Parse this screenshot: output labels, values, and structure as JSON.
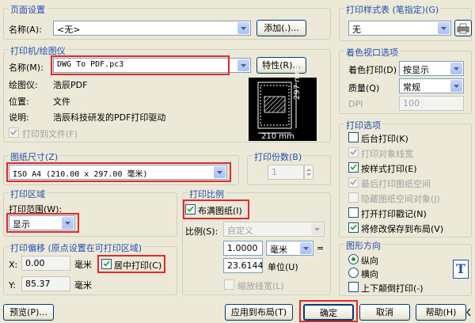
{
  "page_setup": {
    "title": "页面设置",
    "name_label": "名称(A):",
    "name_value": "<无>",
    "add_button": "添加(.)..."
  },
  "printer": {
    "title": "打印机/绘图仪",
    "name_label": "名称(M):",
    "name_value": "DWG To PDF.pc3",
    "properties_button": "特性(R)...",
    "plotter_label": "绘图仪:",
    "plotter_value": "浩辰PDF",
    "location_label": "位置:",
    "location_value": "文件",
    "desc_label": "说明:",
    "desc_value": "浩辰科技研发的PDF打印驱动",
    "print_to_file": "打印到文件(F)",
    "preview_width": "210 mm",
    "preview_height": "297 mm"
  },
  "paper_size": {
    "title": "图纸尺寸(Z)",
    "value": "ISO A4 (210.00 x 297.00 毫米)"
  },
  "copies": {
    "title": "打印份数(B)",
    "value": "1"
  },
  "print_area": {
    "title": "打印区域",
    "range_label": "打印范围(W):",
    "range_value": "显示"
  },
  "scale": {
    "title": "打印比例",
    "fit_paper": "布满图纸(I)",
    "ratio_label": "比例(S):",
    "ratio_value": "自定义",
    "value1": "1.0000",
    "unit_value": "毫米",
    "equals": "=",
    "value2": "23.6144",
    "unit_label": "单位(U)",
    "scale_lineweight": "缩放线宽(L)"
  },
  "offset": {
    "title": "打印偏移 (原点设置在可打印区域)",
    "x_label": "X:",
    "x_value": "0.00",
    "y_label": "Y:",
    "y_value": "85.37",
    "unit": "毫米",
    "center_plot": "居中打印(C)"
  },
  "style_table": {
    "title": "打印样式表 (笔指定)(G)",
    "value": "无"
  },
  "shaded_viewport": {
    "title": "着色视口选项",
    "shade_label": "着色打印(D)",
    "shade_value": "按显示",
    "quality_label": "质量(Q)",
    "quality_value": "常规",
    "dpi_label": "DPI",
    "dpi_value": "100"
  },
  "plot_options": {
    "title": "打印选项",
    "items": [
      {
        "label": "后台打印(K)",
        "checked": false,
        "enabled": true
      },
      {
        "label": "打印对象线宽",
        "checked": true,
        "enabled": false
      },
      {
        "label": "按样式打印(E)",
        "checked": true,
        "enabled": true
      },
      {
        "label": "最后打印图纸空间",
        "checked": true,
        "enabled": false
      },
      {
        "label": "隐藏图纸空间对象(J)",
        "checked": false,
        "enabled": false
      },
      {
        "label": "打开打印戳记(N)",
        "checked": false,
        "enabled": true
      },
      {
        "label": "将修改保存到布局(V)",
        "checked": true,
        "enabled": true
      }
    ]
  },
  "orientation": {
    "title": "图形方向",
    "portrait": "纵向",
    "landscape": "横向",
    "upside_down": "上下颠倒打印(-)",
    "icon_letter": "T"
  },
  "footer": {
    "preview": "预览(P)...",
    "apply_layout": "应用到布局(T)",
    "ok": "确定",
    "cancel": "取消",
    "help": "帮助(H)"
  },
  "colors": {
    "group_title": "#1f4fb4",
    "highlight": "#e8262b",
    "check": "#21a121"
  }
}
